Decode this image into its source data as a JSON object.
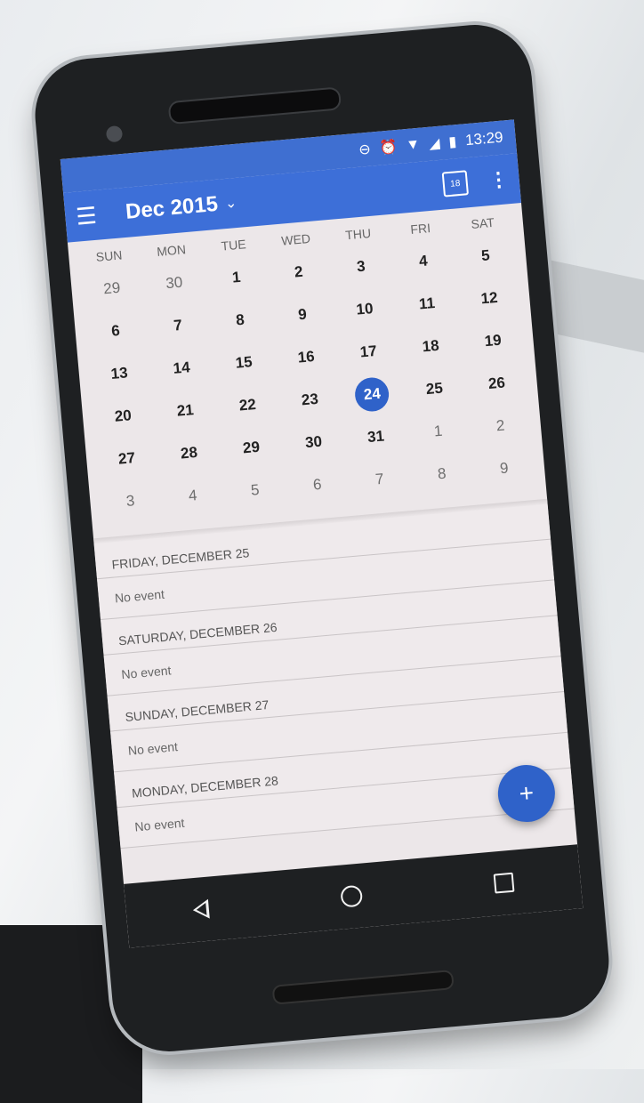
{
  "status_bar": {
    "time": "13:29",
    "icons": [
      "do-not-disturb-icon",
      "alarm-icon",
      "wifi-icon",
      "signal-icon",
      "battery-icon"
    ]
  },
  "app_bar": {
    "title": "Dec 2015",
    "today_icon_label": "18"
  },
  "weekdays": [
    "SUN",
    "MON",
    "TUE",
    "WED",
    "THU",
    "FRI",
    "SAT"
  ],
  "weeks": [
    [
      {
        "d": "29",
        "m": true
      },
      {
        "d": "30",
        "m": true
      },
      {
        "d": "1"
      },
      {
        "d": "2"
      },
      {
        "d": "3"
      },
      {
        "d": "4"
      },
      {
        "d": "5"
      }
    ],
    [
      {
        "d": "6"
      },
      {
        "d": "7"
      },
      {
        "d": "8"
      },
      {
        "d": "9"
      },
      {
        "d": "10"
      },
      {
        "d": "11"
      },
      {
        "d": "12"
      }
    ],
    [
      {
        "d": "13"
      },
      {
        "d": "14"
      },
      {
        "d": "15"
      },
      {
        "d": "16"
      },
      {
        "d": "17"
      },
      {
        "d": "18"
      },
      {
        "d": "19"
      }
    ],
    [
      {
        "d": "20"
      },
      {
        "d": "21"
      },
      {
        "d": "22"
      },
      {
        "d": "23"
      },
      {
        "d": "24",
        "sel": true
      },
      {
        "d": "25"
      },
      {
        "d": "26"
      }
    ],
    [
      {
        "d": "27"
      },
      {
        "d": "28"
      },
      {
        "d": "29"
      },
      {
        "d": "30"
      },
      {
        "d": "31"
      },
      {
        "d": "1",
        "m": true
      },
      {
        "d": "2",
        "m": true
      }
    ],
    [
      {
        "d": "3",
        "m": true
      },
      {
        "d": "4",
        "m": true
      },
      {
        "d": "5",
        "m": true
      },
      {
        "d": "6",
        "m": true
      },
      {
        "d": "7",
        "m": true
      },
      {
        "d": "8",
        "m": true
      },
      {
        "d": "9",
        "m": true
      }
    ]
  ],
  "agenda": [
    {
      "header": "FRIDAY, DECEMBER 25",
      "item": "No event"
    },
    {
      "header": "SATURDAY, DECEMBER 26",
      "item": "No event"
    },
    {
      "header": "SUNDAY, DECEMBER 27",
      "item": "No event"
    },
    {
      "header": "MONDAY, DECEMBER 28",
      "item": "No event"
    }
  ],
  "fab_label": "+",
  "colors": {
    "primary": "#3d6fd8",
    "selected": "#2f62c9"
  }
}
